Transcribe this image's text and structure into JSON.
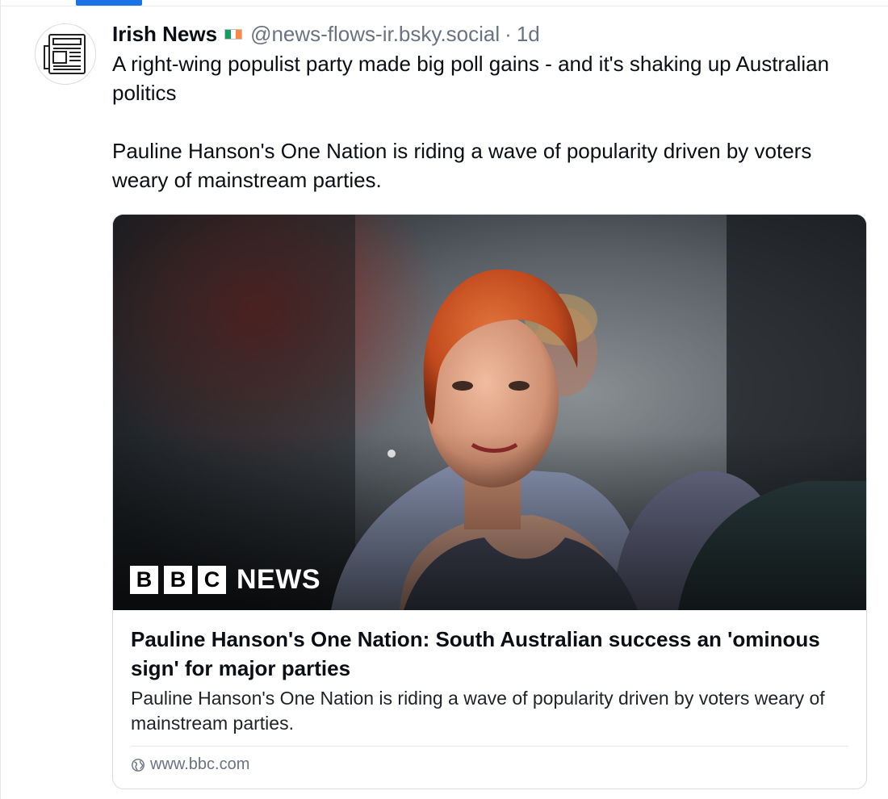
{
  "post": {
    "author": "Irish News",
    "flag_colors": [
      "#169b62",
      "#ffffff",
      "#ff883e"
    ],
    "handle": "@news-flows-ir.bsky.social",
    "separator": "·",
    "time": "1d",
    "text_line1": "A right-wing populist party made big poll gains - and it's shaking up Australian politics",
    "text_line2": "Pauline Hanson's One Nation is riding a wave of popularity driven by voters weary of mainstream parties."
  },
  "card": {
    "logo": {
      "b1": "B",
      "b2": "B",
      "c": "C",
      "news": "NEWS"
    },
    "title": "Pauline Hanson's One Nation: South Australian success an 'ominous sign' for major parties",
    "description": "Pauline Hanson's One Nation is riding a wave of popularity driven by voters weary of mainstream parties.",
    "domain": "www.bbc.com"
  },
  "icons": {
    "avatar": "newspaper-icon",
    "domain": "globe-icon"
  },
  "colors": {
    "accent": "#1b73e8",
    "muted": "#6b7280",
    "text": "#0b0f14"
  }
}
